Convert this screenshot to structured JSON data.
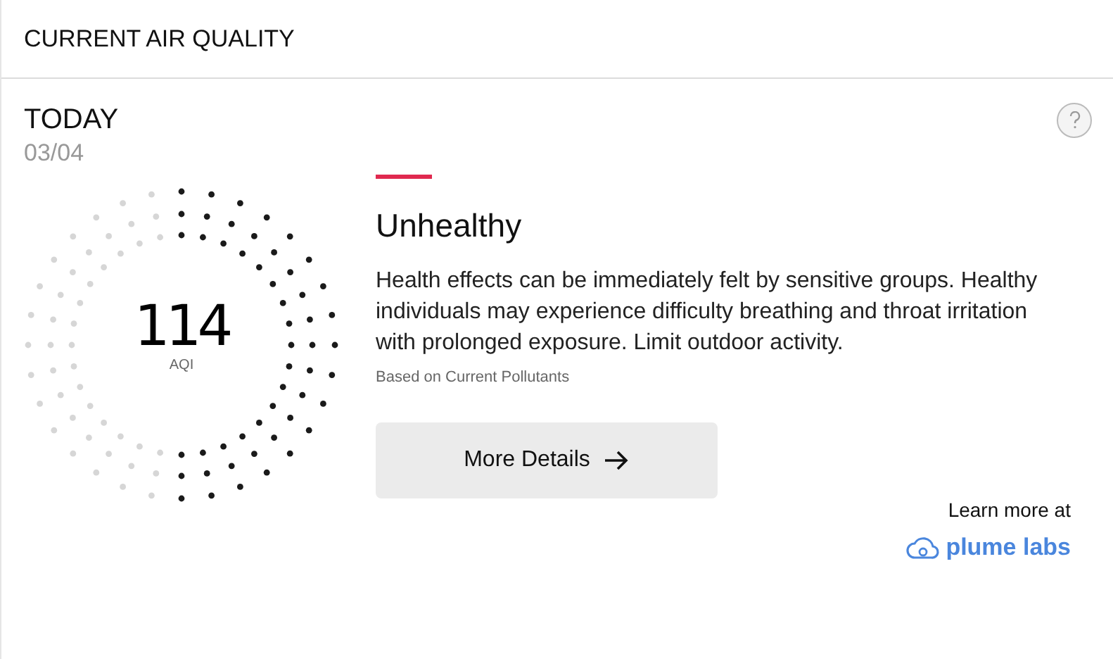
{
  "header": {
    "title": "CURRENT AIR QUALITY"
  },
  "day": {
    "label": "TODAY",
    "date": "03/04"
  },
  "gauge": {
    "value": "114",
    "unit": "AQI",
    "level": 0.53
  },
  "status": {
    "category": "Unhealthy",
    "color": "#e0294f",
    "description": "Health effects can be immediately felt by sensitive groups. Healthy individuals may experience difficulty breathing and throat irritation with prolonged exposure. Limit outdoor activity.",
    "source": "Based on Current Pollutants"
  },
  "button": {
    "label": "More Details"
  },
  "footer": {
    "learn_more": "Learn more at",
    "brand": "plume labs"
  }
}
